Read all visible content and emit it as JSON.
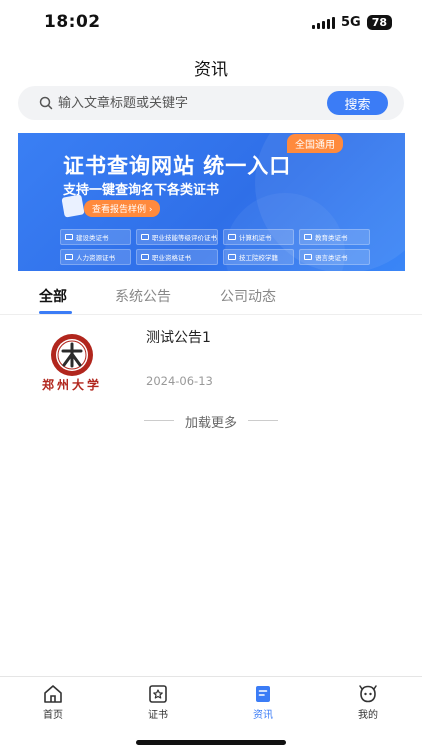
{
  "status_bar": {
    "time": "18:02",
    "network": "5G",
    "battery": "78"
  },
  "nav": {
    "title": "资讯"
  },
  "search": {
    "placeholder": "输入文章标题或关键字",
    "button_label": "搜索"
  },
  "banner": {
    "badge": "全国通用",
    "title": "证书查询网站 统一入口",
    "subtitle": "支持一键查询名下各类证书",
    "cta": "查看报告样例",
    "categories": [
      "建设类证书",
      "职业技能等级评价证书",
      "计算机证书",
      "教育类证书",
      "人力资源证书",
      "职业资格证书",
      "技工院校学籍",
      "语言类证书"
    ]
  },
  "tabs": [
    "全部",
    "系统公告",
    "公司动态"
  ],
  "active_tab": "全部",
  "list": [
    {
      "title": "测试公告1",
      "date": "2024-06-13",
      "logo_text": "郑州大学"
    }
  ],
  "load_more": "加载更多",
  "tabbar": {
    "items": [
      {
        "label": "首页",
        "icon": "home-icon"
      },
      {
        "label": "证书",
        "icon": "certificate-icon"
      },
      {
        "label": "资讯",
        "icon": "news-icon"
      },
      {
        "label": "我的",
        "icon": "profile-icon"
      }
    ],
    "active": "资讯"
  },
  "colors": {
    "accent": "#3b7cf6",
    "banner": "#3a7ff4",
    "badge": "#ff8a3d",
    "logo_red": "#b1261d"
  }
}
